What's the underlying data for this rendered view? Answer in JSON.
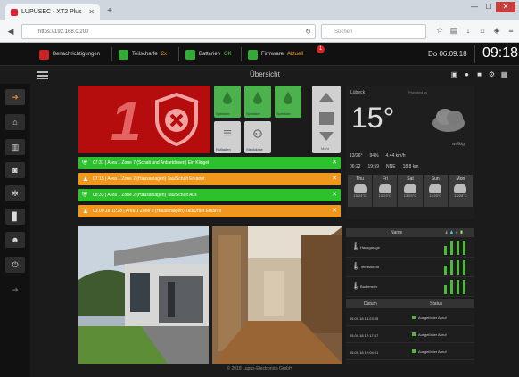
{
  "browser": {
    "tab_title": "LUPUSEC - XT2 Plus",
    "url": "https://192.168.0.200",
    "search_placeholder": "Suchen"
  },
  "statusbar": {
    "notifications": "Benachrichtigungen",
    "partial_armed": "Teilscharfe",
    "partial_value": "2x",
    "batteries": "Batterien",
    "batteries_value": "OK",
    "firmware": "Firmware",
    "firmware_value": "Aktuell",
    "badge": "1",
    "date": "Do 06.09.18",
    "time": "09:18"
  },
  "page": {
    "title": "Übersicht"
  },
  "alarm": {
    "area_number": "1"
  },
  "tiles": [
    {
      "label": "Sprinkler",
      "kind": "drop"
    },
    {
      "label": "Sprinkler",
      "kind": "drop"
    },
    {
      "label": "Sprinkler",
      "kind": "drop"
    },
    {
      "label": "Rollladen",
      "kind": "blind"
    },
    {
      "label": "Steckdose",
      "kind": "socket"
    }
  ],
  "scroll_label": "Mehr",
  "events": [
    {
      "type": "green",
      "text": "07:31 | Area 1 Zone 7 (Schalt und Anbietdosen) Ein Klingel"
    },
    {
      "type": "orange",
      "text": "07:15 | Area 1 Zone 2 (Hausanlagen) Tau/Schalt Erkannt"
    },
    {
      "type": "green",
      "text": "08:33 | Area 1 Zone 2 (Hausanlagen) Tau/Schalt Aus"
    },
    {
      "type": "orange",
      "text": "03.09.18 11:28 | Area 1 Zone 3 (Hausanlagen) Tau/Urset Erkannt"
    }
  ],
  "weather": {
    "location": "Lübeck",
    "provider": "Provided by",
    "temperature": "15°",
    "condition": "wolkig",
    "row1": [
      "13/26°",
      "94%",
      "4.44 km/h"
    ],
    "row2": [
      "06:22",
      "19:59",
      "NNE",
      "18.8 km"
    ],
    "days": [
      {
        "name": "Thu",
        "temps": "15/24°C"
      },
      {
        "name": "Fri",
        "temps": "13/23°C"
      },
      {
        "name": "Sat",
        "temps": "13/25°C"
      },
      {
        "name": "Sun",
        "temps": "11/25°C"
      },
      {
        "name": "Mon",
        "temps": "13/26°C"
      }
    ]
  },
  "sensors": {
    "header_name": "Name",
    "header_icons": "🌡 💧 ☀ 🔋",
    "rows": [
      {
        "name": "Hausgarage"
      },
      {
        "name": "Terrasse/rot"
      },
      {
        "name": "Badfenster"
      }
    ]
  },
  "log": {
    "header_date": "Datum",
    "header_status": "Status",
    "rows": [
      {
        "date": "05.09.18 14:23:05",
        "status": "Ausgelöster Anruf"
      },
      {
        "date": "05.09.18 12:17:07",
        "status": "Ausgelöster Anruf"
      },
      {
        "date": "05.09.18 12:04:01",
        "status": "Ausgelöster Anruf"
      }
    ]
  },
  "footer": "© 2018 Lupus-Electronics GmbH",
  "colors": {
    "alarm_red": "#b50d0d",
    "ok_green": "#2ec12e",
    "warn_orange": "#f1971b",
    "tile_green": "#4db14d",
    "time_white": "#ffffff"
  }
}
